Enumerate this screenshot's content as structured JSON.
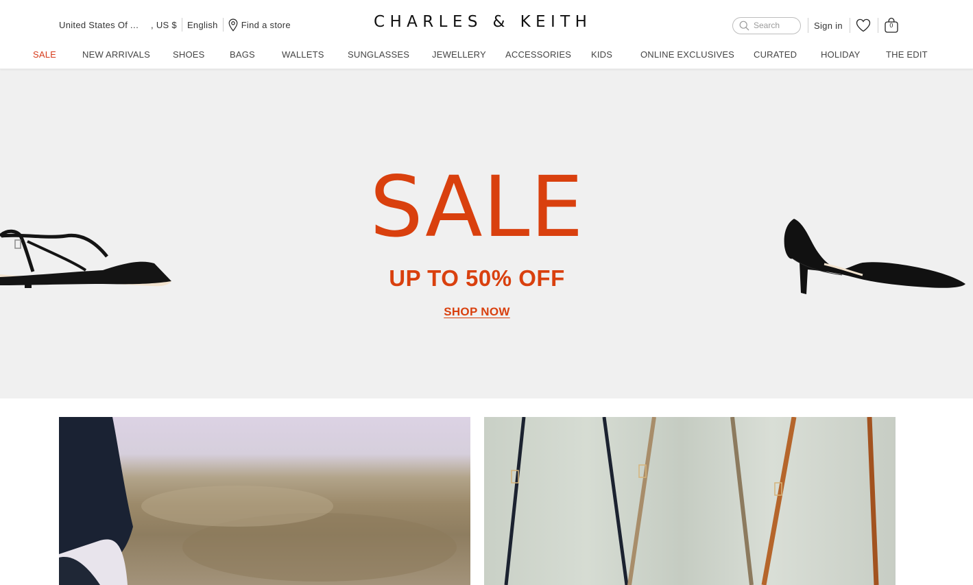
{
  "locale": {
    "country": "United States Of America",
    "currency": ", US $",
    "language": "English",
    "find_store": "Find a store"
  },
  "brand": {
    "logo": "CHARLES & KEITH"
  },
  "search": {
    "placeholder": "Search"
  },
  "account": {
    "sign_in": "Sign in",
    "bag_count": "0"
  },
  "nav": {
    "items": [
      {
        "label": "SALE"
      },
      {
        "label": "NEW ARRIVALS"
      },
      {
        "label": "SHOES"
      },
      {
        "label": "BAGS"
      },
      {
        "label": "WALLETS"
      },
      {
        "label": "SUNGLASSES"
      },
      {
        "label": "JEWELLERY"
      },
      {
        "label": "ACCESSORIES"
      },
      {
        "label": "KIDS"
      },
      {
        "label": "ONLINE EXCLUSIVES"
      },
      {
        "label": "CURATED"
      },
      {
        "label": "HOLIDAY"
      },
      {
        "label": "THE EDIT"
      }
    ]
  },
  "hero": {
    "title": "SALE",
    "subtitle": "UP TO 50% OFF",
    "cta": "SHOP NOW"
  },
  "colors": {
    "accent": "#d9400e",
    "nav_sale": "#d63a1a",
    "hero_bg": "#f0f0f0"
  }
}
